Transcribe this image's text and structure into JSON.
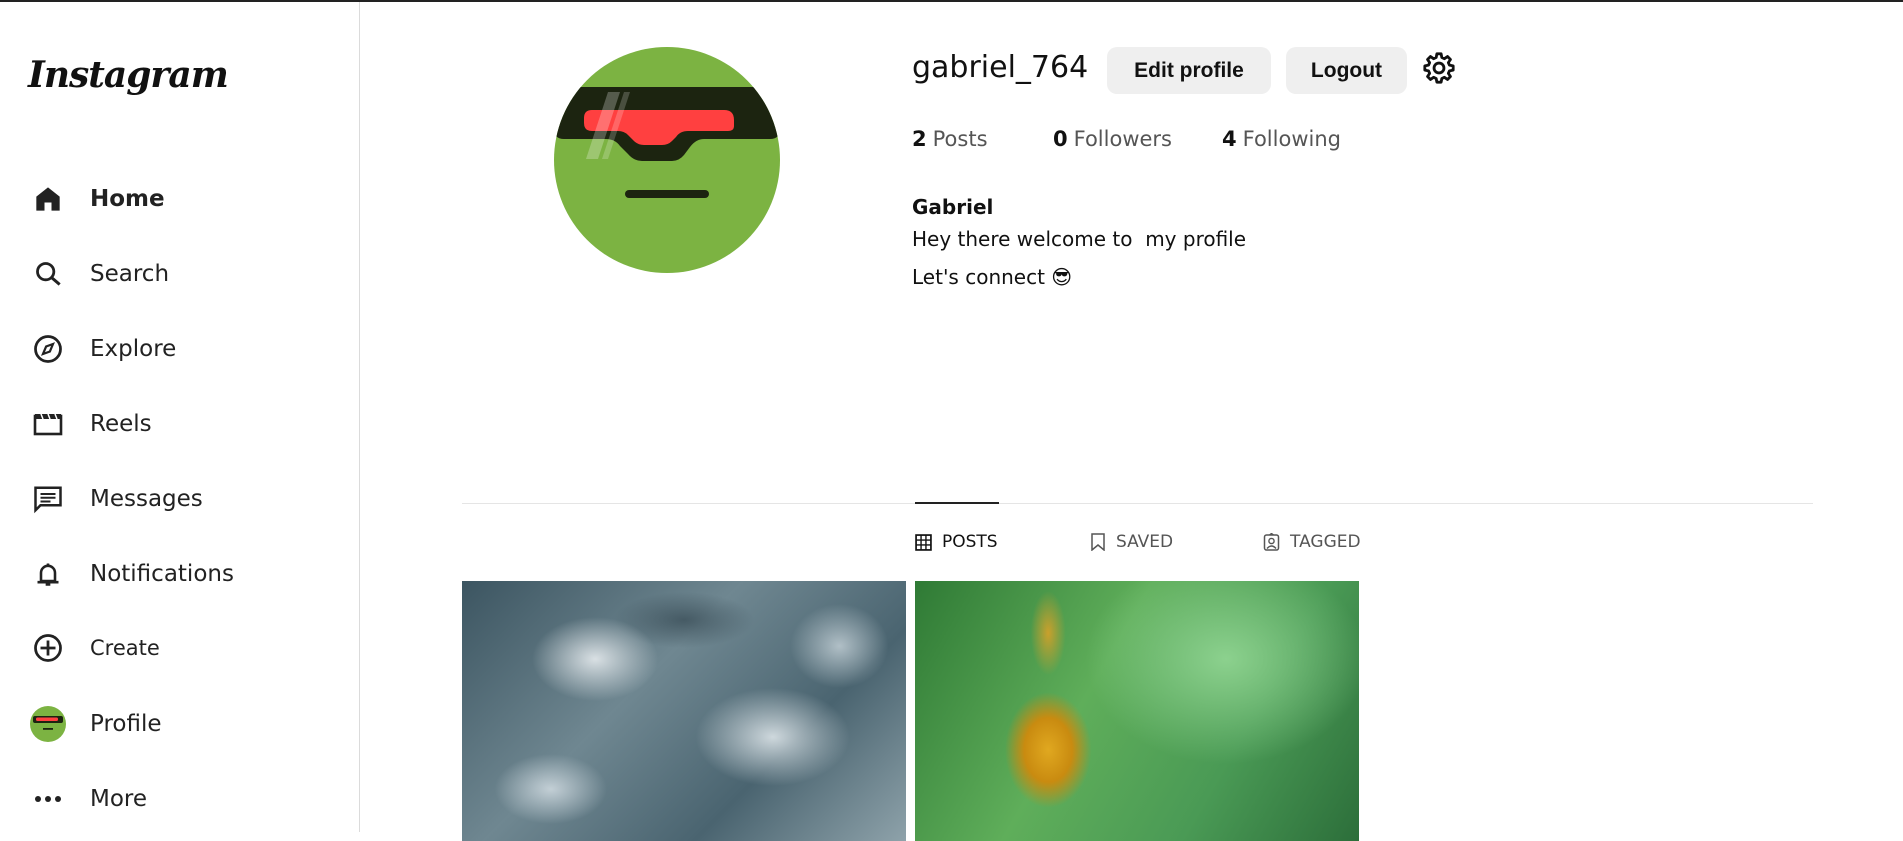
{
  "app": {
    "logo": "Instagram"
  },
  "sidebar": {
    "items": [
      {
        "label": "Home",
        "icon": "home-icon"
      },
      {
        "label": "Search",
        "icon": "search-icon"
      },
      {
        "label": "Explore",
        "icon": "compass-icon"
      },
      {
        "label": "Reels",
        "icon": "reels-icon"
      },
      {
        "label": "Messages",
        "icon": "message-icon"
      },
      {
        "label": "Notifications",
        "icon": "bell-icon"
      },
      {
        "label": "Create",
        "icon": "plus-circle-icon"
      },
      {
        "label": "Profile",
        "icon": "avatar"
      },
      {
        "label": "More",
        "icon": "more-icon"
      }
    ]
  },
  "profile": {
    "username": "gabriel_764",
    "edit_label": "Edit profile",
    "logout_label": "Logout",
    "stats": {
      "posts": "2",
      "posts_label": "Posts",
      "followers": "0",
      "followers_label": "Followers",
      "following": "4",
      "following_label": "Following"
    },
    "name": "Gabriel",
    "bio": [
      "Hey there welcome to  my profile",
      "Let's connect 😎"
    ]
  },
  "tabs": [
    {
      "label": "POSTS",
      "active": true
    },
    {
      "label": "SAVED"
    },
    {
      "label": "TAGGED"
    }
  ],
  "colors": {
    "avatar_bg": "#7cb342",
    "visor": "#1c2410",
    "visor_light": "#ff4040",
    "button_bg": "#efefef"
  }
}
